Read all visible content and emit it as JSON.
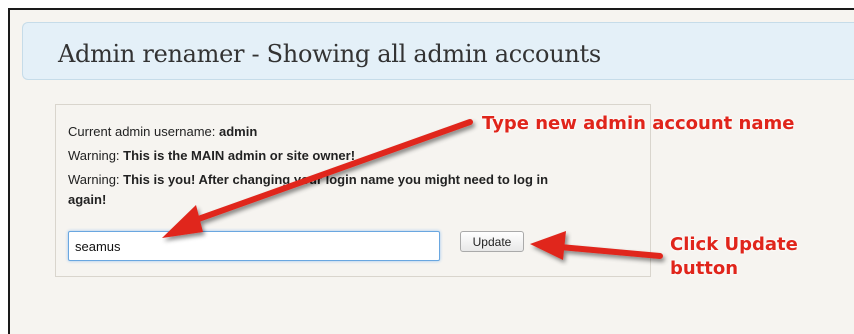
{
  "header": {
    "title": "Admin renamer - Showing all admin accounts"
  },
  "panel": {
    "current_label": "Current admin username: ",
    "current_value": "admin",
    "warning1_label": "Warning: ",
    "warning1_text": "This is the MAIN admin or site owner!",
    "warning2_label": "Warning: ",
    "warning2_text": "This is you! After changing your login name you might need to log in",
    "warning2_cont": "again!",
    "input_value": "seamus",
    "update_label": "Update"
  },
  "annotations": {
    "type_note": "Type new admin account name",
    "click_note_line1": "Click Update",
    "click_note_line2": "button",
    "color": "#e0251b"
  }
}
